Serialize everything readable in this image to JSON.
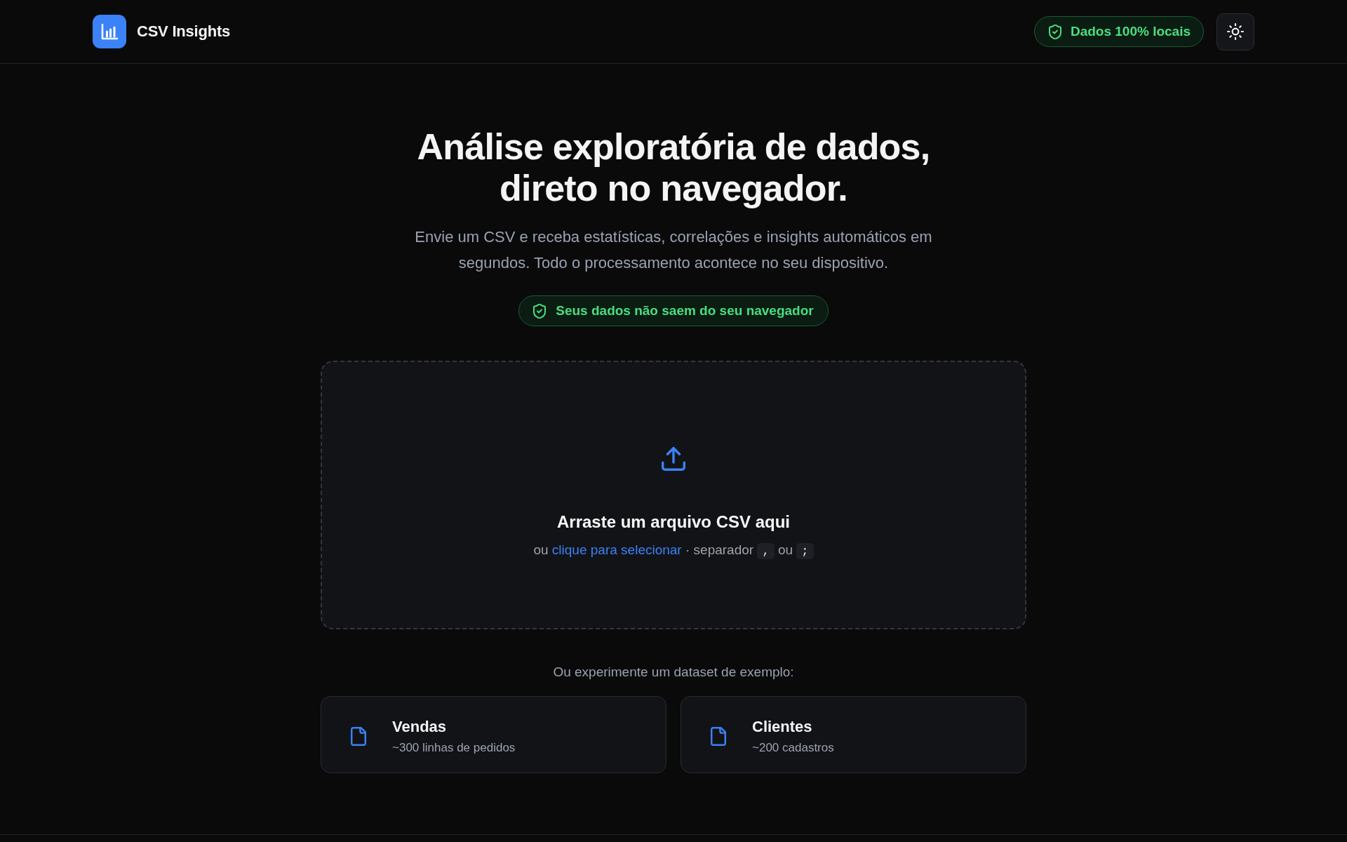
{
  "header": {
    "app_name": "CSV Insights",
    "privacy_badge": "Dados 100% locais"
  },
  "hero": {
    "title": "Análise exploratória de dados, direto no navegador.",
    "subtitle": "Envie um CSV e receba estatísticas, correlações e insights automáticos em segundos. Todo o processamento acontece no seu dispositivo.",
    "privacy_badge": "Seus dados não saem do seu navegador"
  },
  "dropzone": {
    "title": "Arraste um arquivo CSV aqui",
    "hint": {
      "lead": "ou",
      "link": "clique para selecionar",
      "separator_label": "· separador",
      "separators": [
        ",",
        ";"
      ],
      "separator_joiner": "ou"
    }
  },
  "samples": {
    "prompt": "Ou experimente um dataset de exemplo:",
    "datasets": [
      {
        "name": "Vendas",
        "description": "~300 linhas de pedidos"
      },
      {
        "name": "Clientes",
        "description": "~200 cadastros"
      }
    ]
  }
}
